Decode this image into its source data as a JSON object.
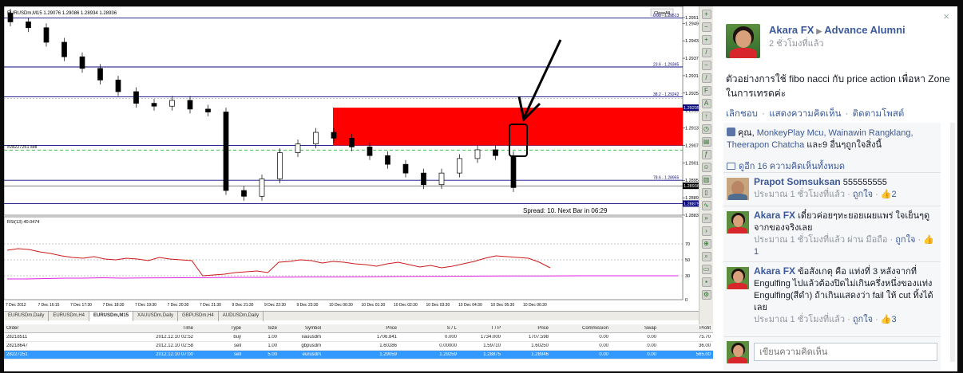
{
  "mt4": {
    "chart_title": "EURUSDm,M15  1.29076 1.29086 1.28934 1.28936",
    "close_all": "CloseAll",
    "order_label": "#28227251 sell",
    "spread_text": "Spread: 10. Next Bar in 06:29",
    "rsi_label": "RSI(13) 40.0474",
    "price_axis": [
      "1.29515",
      "1.29495",
      "1.29435",
      "1.29375",
      "1.29315",
      "1.29255",
      "1.29195",
      "1.29135",
      "1.29075",
      "1.29015",
      "1.28955",
      "1.28895",
      "1.28835"
    ],
    "price_tags": {
      "tag1": "1.29205",
      "tag2": "1.28936",
      "tag3": "1.28875"
    },
    "fibo": {
      "f0": "0.00 - 1.29513",
      "f236": "23.6 - 1.29345",
      "f382": "38.2 - 1.29242",
      "f618": "61.8 - 1.29075",
      "f786": "78.6 - 1.28955"
    },
    "rsi_axis": [
      "70",
      "50",
      "30",
      "0"
    ],
    "time_axis": [
      "7 Dec 2012",
      "7 Dec 16:15",
      "7 Dec 17:30",
      "7 Dec 18:30",
      "7 Dec 19:30",
      "7 Dec 20:30",
      "7 Dec 21:30",
      "9 Dec 21:30",
      "9 Dec 22:30",
      "9 Dec 23:30",
      "10 Dec 00:30",
      "10 Dec 01:30",
      "10 Dec 02:30",
      "10 Dec 03:30",
      "10 Dec 04:30",
      "10 Dec 05:30",
      "10 Dec 06:30"
    ],
    "tabs": [
      {
        "label": "EURUSDm,Daily",
        "active": false
      },
      {
        "label": "EURUSDm,H4",
        "active": false
      },
      {
        "label": "EURUSDm,M15",
        "active": true
      },
      {
        "label": "XAUUSDm,Daily",
        "active": false
      },
      {
        "label": "GBPUSDm,H4",
        "active": false
      },
      {
        "label": "AUDUSDm,Daily",
        "active": false
      }
    ],
    "orders_header": [
      "Order",
      "Time",
      "Type",
      "Size",
      "Symbol",
      "Price",
      "S / L",
      "T / P",
      "Price",
      "Commission",
      "Swap",
      "Profit"
    ],
    "orders": [
      {
        "cells": [
          "28218511",
          "2012.12.10 02:52",
          "buy",
          "1.00",
          "xauusdm",
          "1706.841",
          "0.000",
          "1734.000",
          "1707.598",
          "0.00",
          "0.00",
          "75.70"
        ],
        "selected": false
      },
      {
        "cells": [
          "28218647",
          "2012.12.10 02:58",
          "sell",
          "1.00",
          "gbpusdm",
          "1.60286",
          "0.00000",
          "1.59710",
          "1.60250",
          "0.00",
          "0.00",
          "36.00"
        ],
        "selected": false
      },
      {
        "cells": [
          "28227251",
          "2012.12.10 07:00",
          "sell",
          "5.00",
          "eurusdm",
          "1.29059",
          "1.29259",
          "1.28875",
          "1.28946",
          "0.00",
          "0.00",
          "565.00"
        ],
        "selected": true
      }
    ]
  },
  "fb": {
    "author": "Akara FX",
    "group": "Advance Alumni",
    "time": "2 ชั่วโมงที่แล้ว",
    "post_text": "ตัวอย่างการใช้ fibo nacci กับ price action เพื่อหา Zone ในการเทรดค่ะ",
    "actions": [
      "เลิกชอบ",
      "แสดงความคิดเห็น",
      "ติดตามโพสต์"
    ],
    "likes_prefix": "คุณ, ",
    "likes_names": "MonkeyPlay Mcu, Wainawin Rangklang, Theerapon Chatcha",
    "likes_suffix": " และ9 อื่นๆถูกใจสิ่งนี้",
    "view_more": "ดูอีก 16 ความคิดเห็นทั้งหมด",
    "comments": [
      {
        "name": "Prapot Somsuksan",
        "text": " 555555555",
        "time": "ประมาณ 1 ชั่วโมงที่แล้ว",
        "like": "ถูกใจ",
        "count": "2"
      },
      {
        "name": "Akara FX",
        "text": " เดี๋ยวค่อยๆทะยอยเผยแพร่ ใจเย็นๆดูจากของจริงเลย",
        "time": "ประมาณ 1 ชั่วโมงที่แล้ว ผ่าน มือถือ",
        "like": "ถูกใจ",
        "count": "1"
      },
      {
        "name": "Akara FX",
        "text": " ข้อสังเกตุ คือ แท่งที่ 3 หลังจากที่ Engulfing ไปแล้วต้องปิดไม่เกินครึ่งหนึ่งของแท่ง Engulfing(สีดำ) ถ้าเกินแสดงว่า fail ให้ cut ทิ้งได้เลย",
        "time": "ประมาณ 1 ชั่วโมงที่แล้ว",
        "like": "ถูกใจ",
        "count": "3"
      }
    ],
    "composer_placeholder": "เขียนความคิดเห็น",
    "close_glyph": "×"
  },
  "colors": {
    "zone": "#ff0000",
    "rsi": "#cc1a1a",
    "rsi_ma": "#e020e0",
    "fb_link": "#3b5998",
    "axis": "#0a0a7a"
  },
  "chart_data": {
    "type": "candlestick",
    "title": "EURUSDm,M15",
    "ylim": [
      1.28835,
      1.29515
    ],
    "ohlc_sample_closes": [
      1.295,
      1.2948,
      1.2943,
      1.2938,
      1.2934,
      1.293,
      1.2926,
      1.2922,
      1.2921,
      1.2923,
      1.292,
      1.2919,
      1.2892,
      1.289,
      1.2896,
      1.2905,
      1.2908,
      1.2912,
      1.291,
      1.2907,
      1.2904,
      1.2901,
      1.2898,
      1.2894,
      1.2898,
      1.2903,
      1.2906,
      1.2904,
      1.2893
    ],
    "zone": {
      "from": 1.29075,
      "to": 1.29205
    },
    "rsi": {
      "label": "RSI(13)",
      "value": 40.0474,
      "levels": [
        70,
        50,
        30
      ]
    }
  }
}
